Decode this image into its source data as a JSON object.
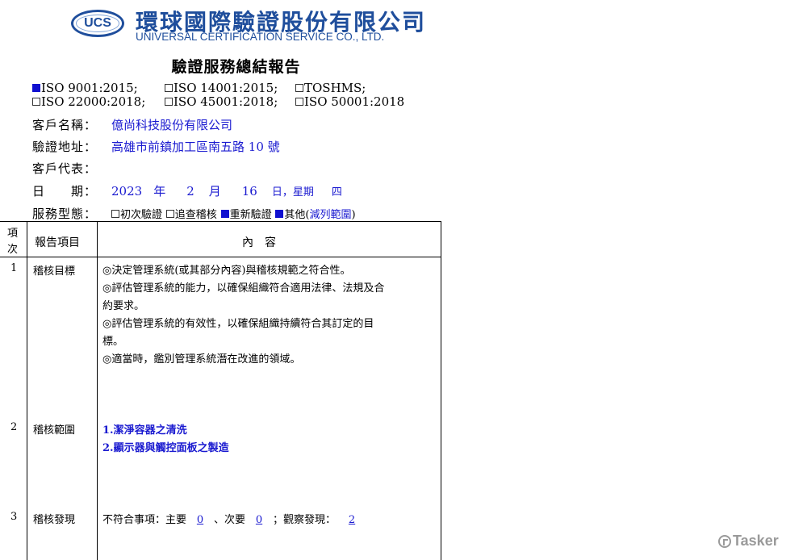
{
  "header": {
    "logo_text": "UCS",
    "company_name_zh": "環球國際驗證股份有限公司",
    "company_name_en": "UNIVERSAL CERTIFICATION SERVICE CO., LTD."
  },
  "report_title": "驗證服務總結報告",
  "standards": [
    {
      "label": "ISO 9001:2015;",
      "checked": true
    },
    {
      "label": "ISO 14001:2015;",
      "checked": false
    },
    {
      "label": "TOSHMS;",
      "checked": false
    },
    {
      "label": "ISO 22000:2018;",
      "checked": false
    },
    {
      "label": "ISO 45001:2018;",
      "checked": false
    },
    {
      "label": "ISO 50001:2018",
      "checked": false
    }
  ],
  "fields": {
    "client_name_label": "客戶名稱：",
    "client_name": "億尚科技股份有限公司",
    "address_label": "驗證地址：",
    "address": "高雄市前鎮加工區南五路 10 號",
    "rep_label": "客戶代表：",
    "rep": "",
    "date_label": "日　　期：",
    "date_year": "2023",
    "date_year_unit": "年",
    "date_month": "2",
    "date_month_unit": "月",
    "date_day": "16",
    "date_day_unit": "日，星期",
    "date_weekday": "四"
  },
  "service_type": {
    "label": "服務型態：",
    "options": [
      {
        "label": "初次驗證",
        "checked": false
      },
      {
        "label": "追查稽核",
        "checked": false
      },
      {
        "label": "重新驗證",
        "checked": true
      },
      {
        "label": "其他(",
        "checked": true
      }
    ],
    "other_note": "減列範圍",
    "other_close": ")"
  },
  "table": {
    "col_no_line1": "項",
    "col_no_line2": "次",
    "col_item": "報告項目",
    "col_content": "內　容",
    "rows": [
      {
        "no": "1",
        "item": "稽核目標",
        "lines": [
          "◎決定管理系統(或其部分內容)與稽核規範之符合性。",
          "◎評估管理系統的能力，以確保組織符合適用法律、法規及合",
          "約要求。",
          "◎評估管理系統的有效性，以確保組織持續符合其訂定的目",
          "標。",
          "◎適當時，鑑別管理系統潛在改進的領域。"
        ]
      },
      {
        "no": "2",
        "item": "稽核範圍",
        "lines": [
          "1.潔淨容器之清洗",
          "2.顯示器與觸控面板之製造"
        ]
      },
      {
        "no": "3",
        "item": "稽核發現",
        "finding_prefix": "不符合事項：主要",
        "major": "0",
        "minor_prefix": "、次要",
        "minor": "0",
        "obs_prefix": "；觀察發現：",
        "observations": "2"
      }
    ]
  },
  "watermark": "Tasker"
}
